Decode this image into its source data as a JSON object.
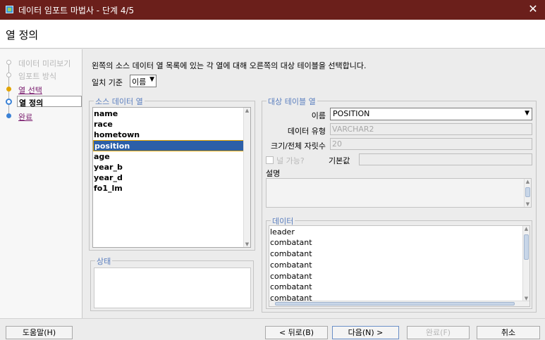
{
  "window": {
    "title": "데이터 임포트 마법사 - 단계 4/5",
    "close_glyph": "✕"
  },
  "header": {
    "page_title": "열 정의"
  },
  "steps": [
    {
      "label": "데이터 미리보기",
      "state": "done"
    },
    {
      "label": "임포트 방식",
      "state": "done"
    },
    {
      "label": "열 선택",
      "state": "link"
    },
    {
      "label": "열 정의",
      "state": "active"
    },
    {
      "label": "완료",
      "state": "link"
    }
  ],
  "main": {
    "instruction": "왼쪽의 소스 데이터 열 목록에 있는 각 열에 대해 오른쪽의 대상 테이블을 선택합니다.",
    "match_label": "일치 기준",
    "match_value": "이름"
  },
  "source": {
    "legend": "소스 데이터 열",
    "items": [
      "name",
      "race",
      "hometown",
      "position",
      "age",
      "year_b",
      "year_d",
      "fo1_lm"
    ],
    "selected_index": 3
  },
  "status": {
    "legend": "상태"
  },
  "target": {
    "legend": "대상 테이블 열",
    "name_label": "이름",
    "name_value": "POSITION",
    "type_label": "데이터 유형",
    "type_value": "VARCHAR2",
    "size_label": "크기/전체 자릿수",
    "size_value": "20",
    "nullable_label": "널 가능?",
    "default_label": "기본값",
    "default_value": "",
    "comment_label": "설명"
  },
  "data": {
    "legend": "데이터",
    "rows": [
      "leader",
      "combatant",
      "combatant",
      "combatant",
      "combatant",
      "combatant",
      "combatant"
    ]
  },
  "buttons": {
    "help": "도움말(H)",
    "back": "< 뒤로(B)",
    "next": "다음(N) >",
    "finish": "완료(F)",
    "cancel": "취소"
  },
  "colors": {
    "titlebar": "#6b1f1b",
    "selection": "#2c5fa8",
    "accent_gold": "#e2a400",
    "link": "#7a1d6e",
    "legend": "#5b7fbf"
  }
}
